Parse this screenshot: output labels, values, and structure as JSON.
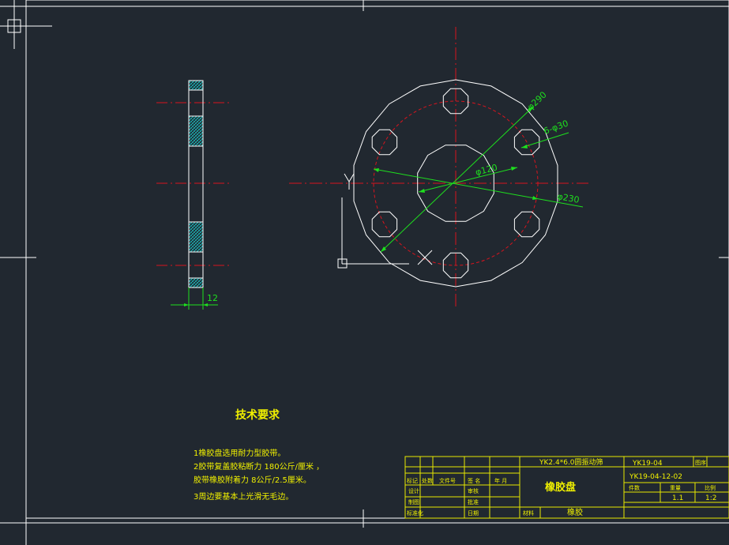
{
  "colors": {
    "background": "#212830",
    "frame": "#ffffff",
    "centerline": "#d8141e",
    "dimension": "#1ee01e",
    "title_block": "#e8e800",
    "text": "#f0f000",
    "hatch": "#18c8c8",
    "cursor": "#ffffff"
  },
  "dimensions": {
    "thickness": "12",
    "outer_dia": "φ290",
    "holes": "6-φ30",
    "inner_dia": "φ120",
    "pitch_dia": "φ230"
  },
  "notes": {
    "heading": "技术要求",
    "line1": "1橡胶盘选用耐力型胶带。",
    "line2": "2胶带复盖胶粘断力  180公斤/厘米 ，",
    "line3": "  胶带橡胶附着力 8公斤/2.5厘米。",
    "line4": "3周边要基本上光滑无毛边。"
  },
  "title_block": {
    "project": "YK2.4*6.0圆振动筛",
    "code_top": "YK19-04",
    "order_label": "图序",
    "part_no": "YK19-04-12-02",
    "part_name": "橡胶盘",
    "weight_label": "件数",
    "qty_label": "重量",
    "scale_label": "比例",
    "qty_value": "1.1",
    "scale_value": "1:2",
    "rev_mark": "标记",
    "rev_count": "处数",
    "rev_doc": "文件号",
    "rev_sign": "签   名",
    "rev_date": "年   月",
    "design": "设计",
    "drafting": "制图",
    "check": "审核",
    "standard": "标准化",
    "process": "工艺",
    "approve": "批准",
    "date": "日期",
    "material_label": "材料",
    "material_value": "橡胶"
  }
}
